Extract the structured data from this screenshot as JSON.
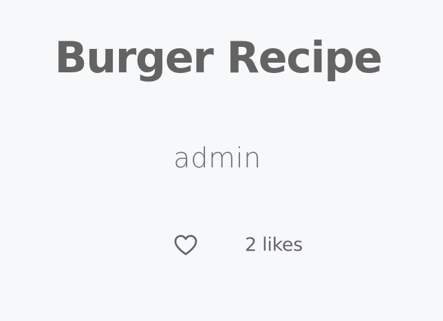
{
  "recipe": {
    "title": "Burger Recipe",
    "author": "admin",
    "likes_label": "2 likes"
  },
  "icons": {
    "like": "heart-outline-icon"
  },
  "colors": {
    "background": "#f7f8fa",
    "text": "#666666"
  }
}
